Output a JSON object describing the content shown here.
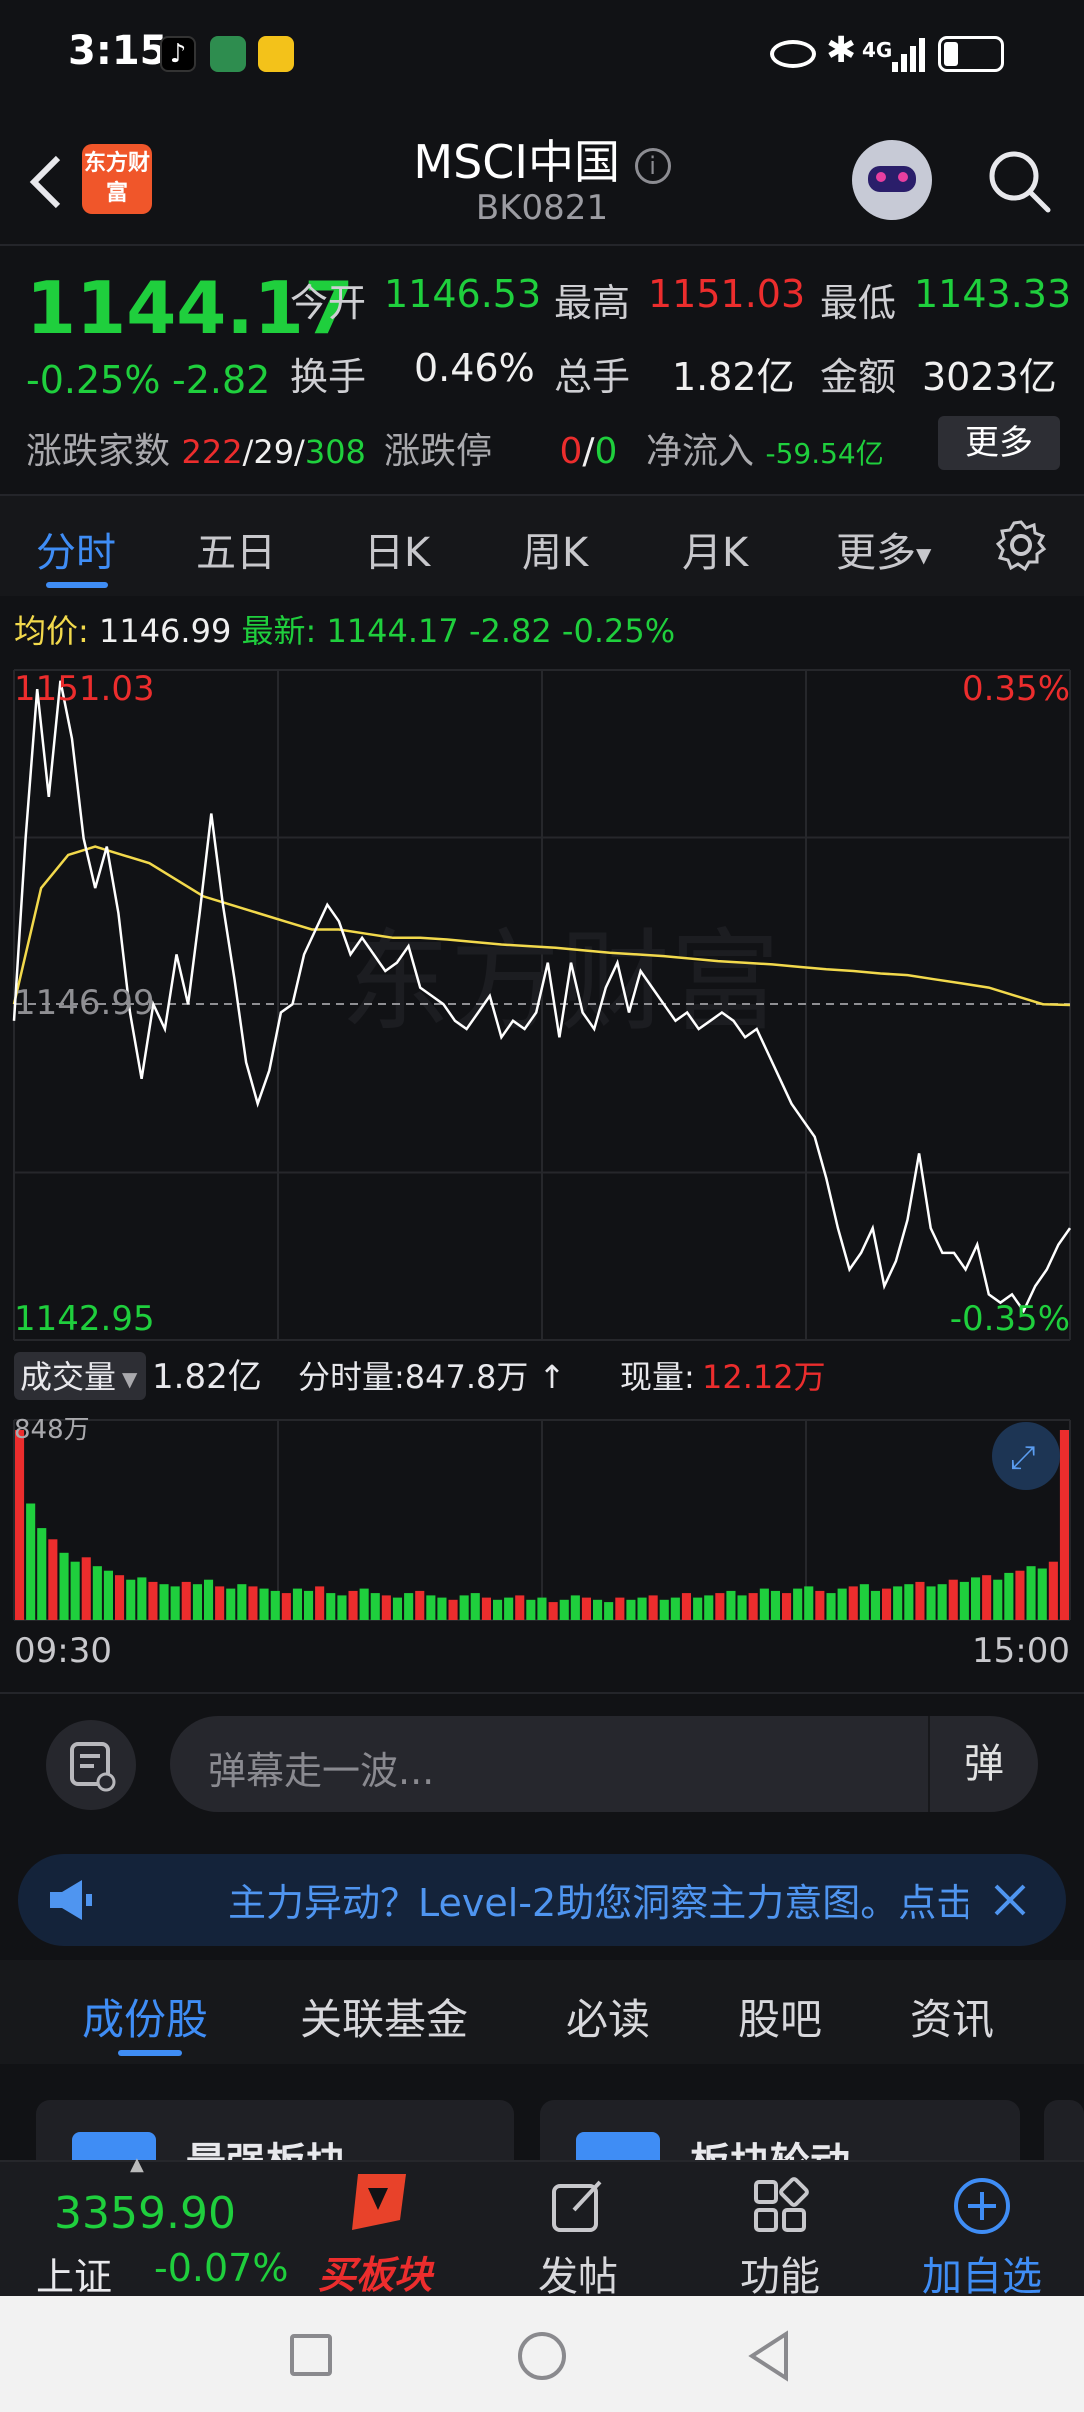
{
  "status": {
    "time": "3:15",
    "network": "4G"
  },
  "header": {
    "logo": "东方财富",
    "title": "MSCI中国",
    "code": "BK0821"
  },
  "quote": {
    "price": "1144.17",
    "change_pct": "-0.25%",
    "change": "-2.82",
    "open_label": "今开",
    "open": "1146.53",
    "high_label": "最高",
    "high": "1151.03",
    "low_label": "最低",
    "low": "1143.33",
    "turnover_label": "换手",
    "turnover": "0.46%",
    "volume_label": "总手",
    "volume": "1.82亿",
    "amount_label": "金额",
    "amount": "3023亿",
    "breadth_label": "涨跌家数",
    "breadth_up": "222",
    "breadth_flat": "29",
    "breadth_down": "308",
    "limit_label": "涨跌停",
    "limit_up": "0",
    "limit_down": "0",
    "inflow_label": "净流入",
    "inflow": "-59.54亿",
    "more_label": "更多"
  },
  "tabs": [
    "分时",
    "五日",
    "日K",
    "周K",
    "月K",
    "更多"
  ],
  "avg_bar": {
    "avg_label": "均价:",
    "avg": "1146.99",
    "latest_label": "最新:",
    "latest": "1144.17",
    "change": "-2.82",
    "change_pct": "-0.25%"
  },
  "chart_data": {
    "type": "line",
    "y_max": "1151.03",
    "y_mid": "1146.99",
    "y_min": "1142.95",
    "pct_max": "0.35%",
    "pct_min": "-0.35%",
    "ylim": [
      1142.95,
      1151.03
    ],
    "x_start": "09:30",
    "x_end": "15:00",
    "price": [
      1146.8,
      1149.0,
      1150.8,
      1149.5,
      1150.9,
      1150.2,
      1149.0,
      1148.4,
      1148.9,
      1148.1,
      1146.9,
      1146.1,
      1147.0,
      1146.7,
      1147.6,
      1147.0,
      1148.1,
      1149.3,
      1148.2,
      1147.3,
      1146.3,
      1145.8,
      1146.2,
      1146.9,
      1147.0,
      1147.6,
      1147.9,
      1148.2,
      1148.0,
      1147.6,
      1147.8,
      1147.6,
      1147.4,
      1147.5,
      1147.7,
      1147.2,
      1147.1,
      1147.0,
      1146.8,
      1146.7,
      1146.9,
      1147.1,
      1146.6,
      1146.8,
      1146.7,
      1146.9,
      1147.5,
      1146.6,
      1147.5,
      1146.9,
      1146.7,
      1147.2,
      1147.5,
      1146.9,
      1147.4,
      1147.2,
      1147.0,
      1146.8,
      1146.9,
      1146.7,
      1146.8,
      1146.9,
      1146.8,
      1146.6,
      1146.7,
      1146.4,
      1146.1,
      1145.8,
      1145.6,
      1145.4,
      1144.9,
      1144.3,
      1143.8,
      1144.0,
      1144.3,
      1143.6,
      1143.9,
      1144.4,
      1145.2,
      1144.3,
      1144.0,
      1144.0,
      1143.8,
      1144.1,
      1143.5,
      1143.4,
      1143.5,
      1143.3,
      1143.6,
      1143.8,
      1144.1,
      1144.3
    ],
    "avg": [
      1147.0,
      1148.4,
      1148.8,
      1148.9,
      1148.8,
      1148.7,
      1148.5,
      1148.3,
      1148.2,
      1148.1,
      1148.0,
      1147.9,
      1147.9,
      1147.85,
      1147.8,
      1147.8,
      1147.78,
      1147.75,
      1147.72,
      1147.7,
      1147.68,
      1147.65,
      1147.62,
      1147.6,
      1147.58,
      1147.55,
      1147.52,
      1147.5,
      1147.48,
      1147.45,
      1147.42,
      1147.4,
      1147.37,
      1147.35,
      1147.3,
      1147.25,
      1147.2,
      1147.1,
      1147.0,
      1146.99
    ],
    "volume_label": "成交量",
    "volume_total": "1.82亿",
    "volume_minute": "分时量:847.8万",
    "volume_now_label": "现量:",
    "volume_now": "12.12万",
    "volume_axis_max": "848万",
    "volume": [
      848,
      520,
      410,
      360,
      300,
      260,
      280,
      240,
      220,
      200,
      180,
      190,
      170,
      160,
      150,
      170,
      160,
      180,
      150,
      140,
      160,
      150,
      140,
      130,
      120,
      140,
      130,
      150,
      120,
      110,
      130,
      140,
      120,
      110,
      100,
      120,
      130,
      110,
      100,
      90,
      110,
      120,
      100,
      90,
      100,
      110,
      90,
      100,
      80,
      90,
      110,
      100,
      90,
      80,
      100,
      90,
      100,
      110,
      90,
      100,
      120,
      100,
      110,
      120,
      130,
      110,
      120,
      140,
      130,
      120,
      140,
      150,
      130,
      120,
      140,
      150,
      160,
      130,
      140,
      150,
      160,
      170,
      150,
      160,
      180,
      170,
      190,
      200,
      180,
      210,
      220,
      240,
      230,
      260,
      848
    ]
  },
  "danmaku": {
    "placeholder": "弹幕走一波...",
    "button": "弹"
  },
  "banner": {
    "text": "主力异动？Level-2助您洞察主力意图。点击"
  },
  "subtabs": [
    "成份股",
    "关联基金",
    "必读",
    "股吧",
    "资讯"
  ],
  "cards": [
    "最强板块",
    "板块轮动"
  ],
  "bottom": {
    "index_value": "3359.90",
    "index_name": "上证",
    "index_change": "-0.07%",
    "buy": "买板块",
    "post": "发帖",
    "func": "功能",
    "add": "加自选"
  },
  "colors": {
    "up": "#ec2d2d",
    "down": "#1fcf3d",
    "accent": "#3f8df5",
    "avg": "#f2d94c"
  }
}
